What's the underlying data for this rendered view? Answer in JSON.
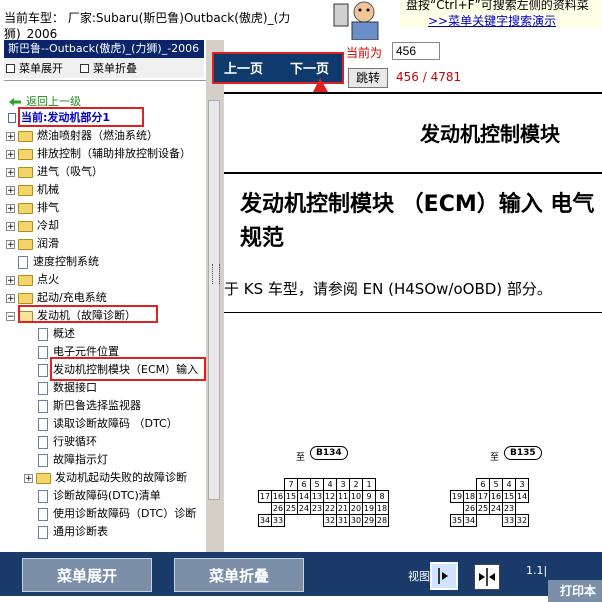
{
  "header": {
    "car_info": "当前车型：  厂家:Subaru(斯巴鲁)Outback(傲虎)_(力狮)_2006",
    "hint_text": "盘按“Ctrl+F”可搜索左侧的资料菜",
    "hint_link": ">>菜单关键字搜索演示"
  },
  "left_panel": {
    "title": "斯巴鲁--Outback(傲虎)_(力狮)_-2006",
    "expand_label": "菜单展开",
    "collapse_label": "菜单折叠",
    "back_label": "返回上一级",
    "current_label": "当前:发动机部分1",
    "tree_items": [
      {
        "label": "燃油喷射器（燃油系统）"
      },
      {
        "label": "排放控制（辅助排放控制设备）"
      },
      {
        "label": "进气（吸气）"
      },
      {
        "label": "机械"
      },
      {
        "label": "排气"
      },
      {
        "label": "冷却"
      },
      {
        "label": "润滑"
      },
      {
        "label": "速度控制系统"
      },
      {
        "label": "点火"
      },
      {
        "label": "起动/充电系统"
      },
      {
        "label": "发动机（故障诊断）"
      }
    ],
    "sub_items": [
      {
        "label": "概述"
      },
      {
        "label": "电子元件位置"
      },
      {
        "label": "发动机控制模块（ECM）输入"
      },
      {
        "label": "数据接口"
      },
      {
        "label": "斯巴鲁选择监视器"
      },
      {
        "label": "读取诊断故障码 （DTC）"
      },
      {
        "label": "行驶循环"
      },
      {
        "label": "故障指示灯"
      },
      {
        "label": "发动机起动失败的故障诊断"
      },
      {
        "label": "诊断故障码(DTC)清单"
      },
      {
        "label": "使用诊断故障码（DTC）诊断"
      },
      {
        "label": "通用诊断表"
      }
    ]
  },
  "nav": {
    "prev_label": "上一页",
    "next_label": "下一页",
    "current_page_label": "当前为",
    "page_input_value": "456",
    "jump_label": "跳转",
    "page_count": "456 / 4781"
  },
  "document": {
    "header": "发动机控制模块",
    "title": "发动机控制模块 （ECM）输入 电气规范",
    "note": "于 KS 车型，请参阅 EN (H4SOw/oOBD) 部分。",
    "connector1": {
      "prefix": "至",
      "name": "B134",
      "rows": [
        [
          "7",
          "6",
          "5",
          "4",
          "3",
          "2",
          "1"
        ],
        [
          "17",
          "16",
          "15",
          "14",
          "13",
          "12",
          "11",
          "10",
          "9",
          "8"
        ],
        [
          "26",
          "25",
          "24",
          "23",
          "22",
          "21",
          "20",
          "19",
          "18"
        ],
        [
          "34",
          "33",
          "",
          "",
          "",
          "32",
          "31",
          "30",
          "29",
          "28",
          "27"
        ]
      ]
    },
    "connector2": {
      "prefix": "至",
      "name": "B135",
      "rows": [
        [
          "6",
          "5",
          "4",
          "3"
        ],
        [
          "19",
          "18",
          "17",
          "16",
          "15",
          "14"
        ],
        [
          "26",
          "25",
          "24",
          "23"
        ],
        [
          "35",
          "34",
          "33",
          "32"
        ]
      ]
    }
  },
  "bottom": {
    "expand_label": "菜单展开",
    "collapse_label": "菜单折叠",
    "view_label": "视图",
    "zoom_text": "1.1|",
    "print_label": "打印本"
  },
  "colors": {
    "nav_bg": "#0e3a6e",
    "highlight": "#e02020",
    "bottom_bg": "#1a3a6a",
    "page_red": "#cc0000"
  }
}
